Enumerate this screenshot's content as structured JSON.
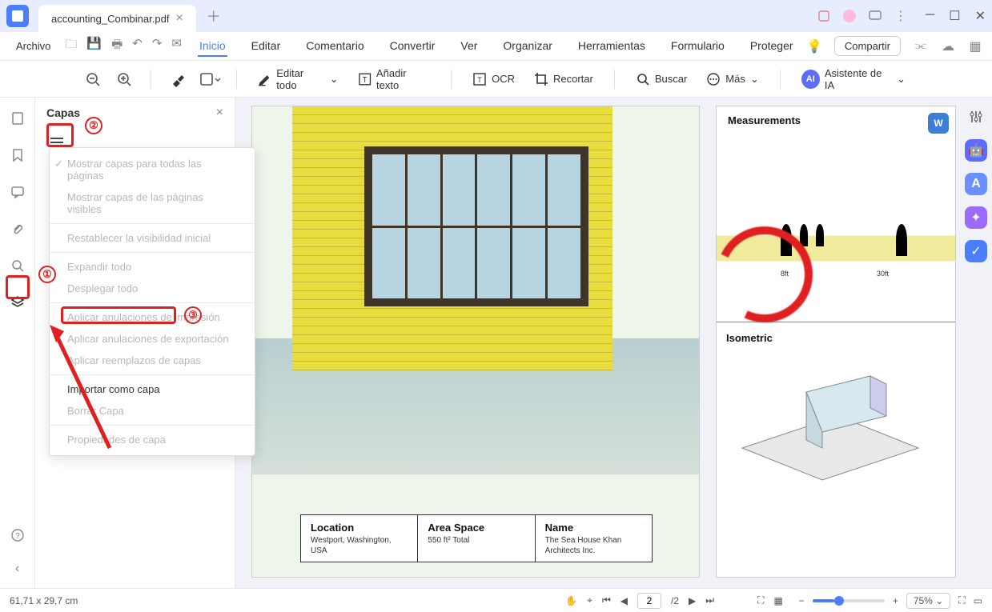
{
  "titlebar": {
    "tab_name": "accounting_Combinar.pdf"
  },
  "menubar": {
    "file": "Archivo",
    "items": [
      "Inicio",
      "Editar",
      "Comentario",
      "Convertir",
      "Ver",
      "Organizar",
      "Herramientas",
      "Formulario",
      "Proteger"
    ],
    "active_index": 0,
    "share": "Compartir"
  },
  "toolbar": {
    "edit_all": "Editar todo",
    "add_text": "Añadir texto",
    "ocr": "OCR",
    "crop": "Recortar",
    "search": "Buscar",
    "more": "Más",
    "ai_assistant": "Asistente de IA"
  },
  "panel": {
    "title": "Capas"
  },
  "dropdown": {
    "show_all": "Mostrar capas para todas las páginas",
    "show_visible": "Mostrar capas de las páginas visibles",
    "reset_vis": "Restablecer la visibilidad inicial",
    "expand": "Expandir todo",
    "collapse": "Desplegar todo",
    "apply_print": "Aplicar anulaciones de impresión",
    "apply_export": "Aplicar anulaciones de exportación",
    "apply_replace": "Aplicar reemplazos de capas",
    "import": "Importar como capa",
    "delete": "Borrar Capa",
    "props": "Propiedades de capa"
  },
  "doc": {
    "measurements": "Measurements",
    "isometric": "Isometric",
    "dim1": "8ft",
    "dim2": "30ft",
    "info": {
      "loc_label": "Location",
      "loc_val": "Westport,\nWashington, USA",
      "area_label": "Area Space",
      "area_val": "550 ft²\nTotal",
      "name_label": "Name",
      "name_val": "The Sea House\nKhan Architects Inc."
    }
  },
  "status": {
    "coords": "61,71 x 29,7 cm",
    "page_current": "2",
    "page_total": "/2",
    "zoom": "75%"
  },
  "annotations": {
    "n1": "①",
    "n2": "②",
    "n3": "③"
  }
}
